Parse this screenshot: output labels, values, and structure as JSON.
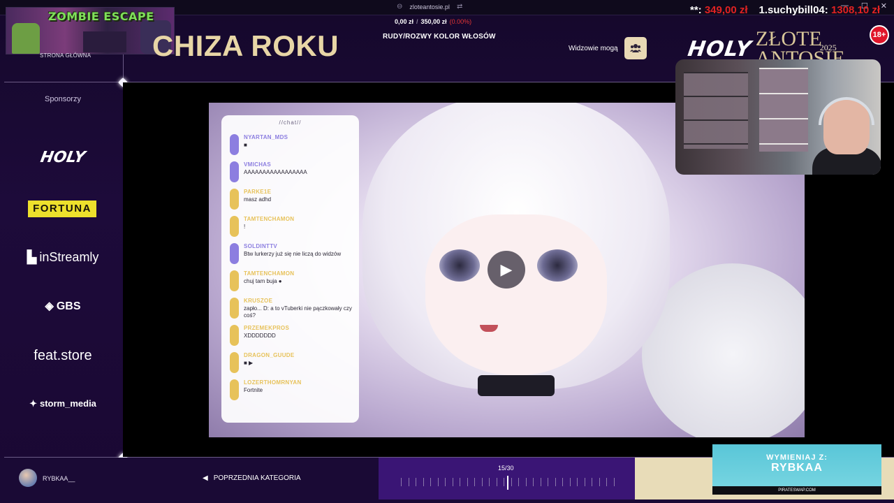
{
  "browser": {
    "url": "zloteantosie.pl",
    "controls": [
      "—",
      "☐",
      "✕"
    ]
  },
  "overlay": {
    "game_title": "ZOMBIE ESCAPE",
    "donation": {
      "prefix": "**:",
      "amount": "349,00 zł",
      "top_donor": "1.suchybill04:",
      "top_amount": "1308,10 zł"
    },
    "age_badge": "18+",
    "brand": {
      "holy": "HOLY",
      "event": "ZŁOTE ANTOSIE",
      "year": "2025"
    }
  },
  "header": {
    "home_link": "STRONA GŁÓWNA",
    "category_title": "CHIZA ROKU",
    "amount_raised": "0,00 zł",
    "amount_goal": "350,00 zł",
    "amount_pct": "(0.00%)",
    "category_subtitle": "RUDY/ROZWY KOLOR WŁOSÓW",
    "viewers_label": "Widzowie mogą"
  },
  "sidebar": {
    "sponsors_label": "Sponsorzy",
    "sponsors": [
      "HOLY",
      "FORTUNA",
      "inStreamly",
      "GBS",
      "feat.store",
      "storm_media"
    ]
  },
  "chat": {
    "header": "//chat//",
    "messages": [
      {
        "user": "NYARTAN_MDS",
        "text": "■",
        "color": "#8c7ee0"
      },
      {
        "user": "VMICHAS",
        "text": "AAAAAAAAAAAAAAAAA",
        "color": "#8c7ee0"
      },
      {
        "user": "PARKE1E",
        "text": "masz adhd",
        "color": "#e7c25a"
      },
      {
        "user": "TAMTENCHAMON",
        "text": "!",
        "color": "#e7c25a"
      },
      {
        "user": "SOLDINTTV",
        "text": "Btw lurkerzy już się nie liczą do widzów",
        "color": "#8c7ee0"
      },
      {
        "user": "TAMTENCHAMON",
        "text": "chuj tam buja ●",
        "color": "#e7c25a"
      },
      {
        "user": "KRUSZOE",
        "text": "zapło... D: a to vTuberki nie pączkowały czy coś?",
        "color": "#e7c25a"
      },
      {
        "user": "PRZEMEKPROS",
        "text": "XDDDDDDD",
        "color": "#e7c25a"
      },
      {
        "user": "DRAGON_GUUDE",
        "text": "■ ▶",
        "color": "#e7c25a"
      },
      {
        "user": "LOZERTHOMRNYAN",
        "text": "Fortnite",
        "color": "#e7c25a"
      }
    ]
  },
  "footer": {
    "username": "RYBKAA__",
    "prev_category": "POPRZEDNIA KATEGORIA",
    "progress": "15/30",
    "progress_value": 0.5
  },
  "promo": {
    "line1": "WYMIENIAJ Z:",
    "line2": "RYBKAA",
    "line3": "PIRATESWAP.COM"
  }
}
